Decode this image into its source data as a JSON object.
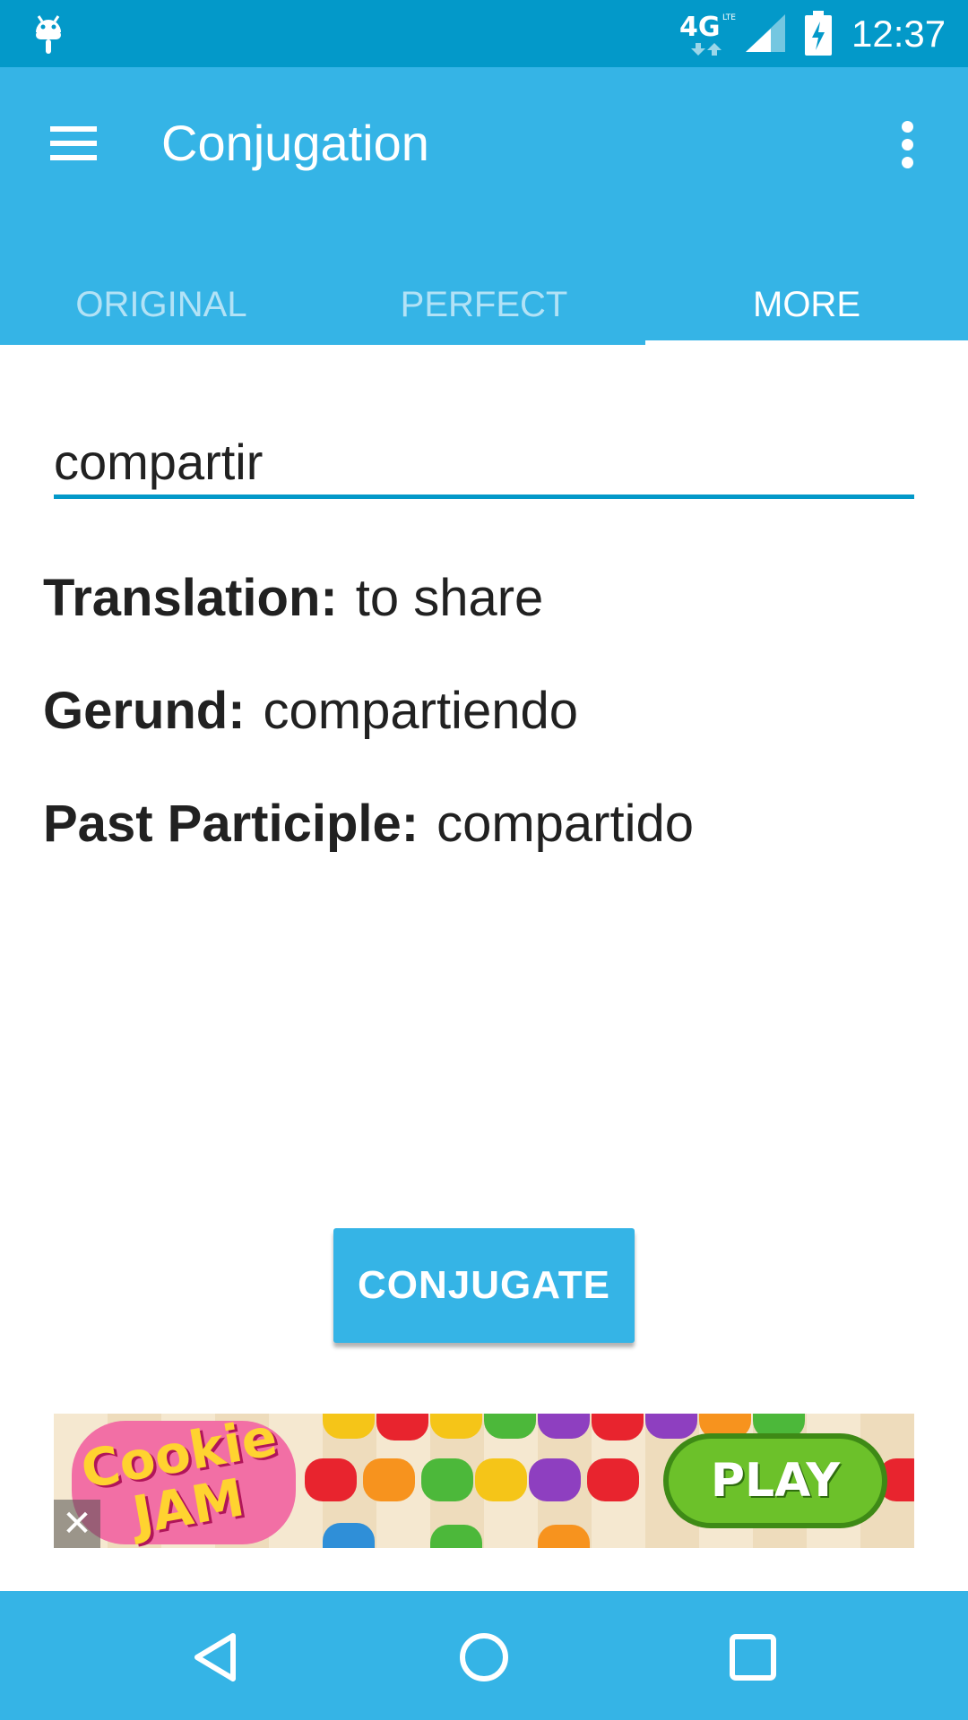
{
  "status_bar": {
    "network_label": "4G",
    "network_sub": "LTE",
    "time": "12:37"
  },
  "app_bar": {
    "title": "Conjugation",
    "tabs": [
      {
        "label": "ORIGINAL",
        "active": false
      },
      {
        "label": "PERFECT",
        "active": false
      },
      {
        "label": "MORE",
        "active": true
      }
    ]
  },
  "main": {
    "verb_input": {
      "value": "compartir"
    },
    "rows": [
      {
        "label": "Translation:",
        "value": "to share"
      },
      {
        "label": "Gerund:",
        "value": "compartiendo"
      },
      {
        "label": "Past Participle:",
        "value": "compartido"
      }
    ],
    "conjugate_label": "CONJUGATE"
  },
  "ad": {
    "logo_text": "Cookie JAM",
    "play_label": "PLAY",
    "close_glyph": "✕"
  },
  "nav_bar": {
    "icons": [
      "back-icon",
      "home-icon",
      "recents-icon"
    ]
  },
  "colors": {
    "status_bar": "#0399c9",
    "primary": "#35b4e6",
    "accent_line": "#0399c9",
    "text": "#212121"
  }
}
